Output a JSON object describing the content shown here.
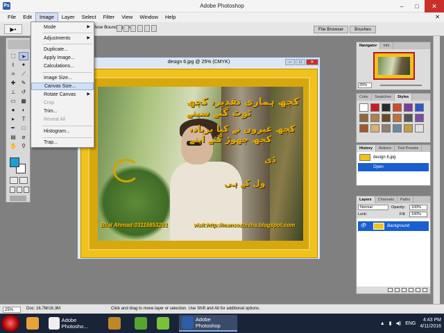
{
  "window": {
    "title": "Adobe Photoshop",
    "min": "–",
    "max": "□",
    "close": "✕"
  },
  "menubar": {
    "items": [
      "File",
      "Edit",
      "Image",
      "Layer",
      "Select",
      "Filter",
      "View",
      "Window",
      "Help"
    ],
    "active": "Image",
    "doc_close": "✕"
  },
  "options": {
    "tool_preset": "▶•",
    "bounding_box": "Show Bounding Box",
    "tabs": [
      "File Browser",
      "Brushes"
    ]
  },
  "image_menu": {
    "mode": "Mode",
    "adjustments": "Adjustments",
    "duplicate": "Duplicate...",
    "apply_image": "Apply Image...",
    "calculations": "Calculations...",
    "image_size": "Image Size...",
    "canvas_size": "Canvas Size...",
    "rotate_canvas": "Rotate Canvas",
    "crop": "Crop",
    "trim": "Trim...",
    "reveal_all": "Reveal All",
    "histogram": "Histogram...",
    "trap": "Trap...",
    "submenu_arrow": "▶"
  },
  "document": {
    "title": "design 6.jpg @ 25% (CMYK)",
    "poetry_line1": "کچھ ہماری تقدیر، کچھ ٹوٹ گئے سپنے",
    "poetry_line2": "کچھ غیروں نے کیا برباد، کچھ چھوڑ گئے اپنے",
    "poetry_line3": "ڈی",
    "poetry_line4": "ول کے ہی",
    "credit_left": "Bilal Ahmad:03115853281",
    "credit_right": "visit:http://mansozbisha.blogspot.com"
  },
  "navigator": {
    "tabs": [
      "Navigator",
      "Info"
    ],
    "zoom": "25%"
  },
  "color_panel": {
    "tabs": [
      "Color",
      "Swatches",
      "Styles"
    ],
    "active": "Styles",
    "swatches": [
      "#ffffff",
      "#c81e1e",
      "#2b2b2b",
      "#d04a2a",
      "#7a3c9c",
      "#3355cc",
      "#8a6a3a",
      "#b08050",
      "#6a4a2a",
      "#c07040",
      "#555555",
      "#7b4fa0",
      "#a05a2a",
      "#d8b070",
      "#908070",
      "#6a8aa0",
      "#c0a040",
      "#e0e0e0"
    ]
  },
  "history": {
    "tabs": [
      "History",
      "Actions",
      "Tool Presets"
    ],
    "active": "History",
    "snapshot": "design 6.jpg",
    "step": "Open"
  },
  "layers": {
    "tabs": [
      "Layers",
      "Channels",
      "Paths"
    ],
    "active": "Layers",
    "blend_mode": "Normal",
    "opacity_label": "Opacity:",
    "opacity": "100%",
    "lock_label": "Lock:",
    "fill_label": "Fill:",
    "fill": "100%",
    "layer_name": "Background"
  },
  "status": {
    "zoom": "25%",
    "doc": "Doc: 16.7M/16.3M",
    "hint": "Click and drag to move layer or selection. Use Shift and Alt for additional options."
  },
  "taskbar": {
    "items": [
      {
        "label": "",
        "color": "#e8a23a"
      },
      {
        "label": "Adobe Photosho...",
        "color": "#eeeeee"
      },
      {
        "label": "",
        "color": "#c0862a"
      },
      {
        "label": "",
        "color": "#55a630"
      },
      {
        "label": "",
        "color": "#7ac13a"
      },
      {
        "label": "Adobe Photoshop",
        "color": "#2a5ea8"
      }
    ],
    "lang": "ENG",
    "time": "4:43 PM",
    "date": "4/11/2016"
  }
}
